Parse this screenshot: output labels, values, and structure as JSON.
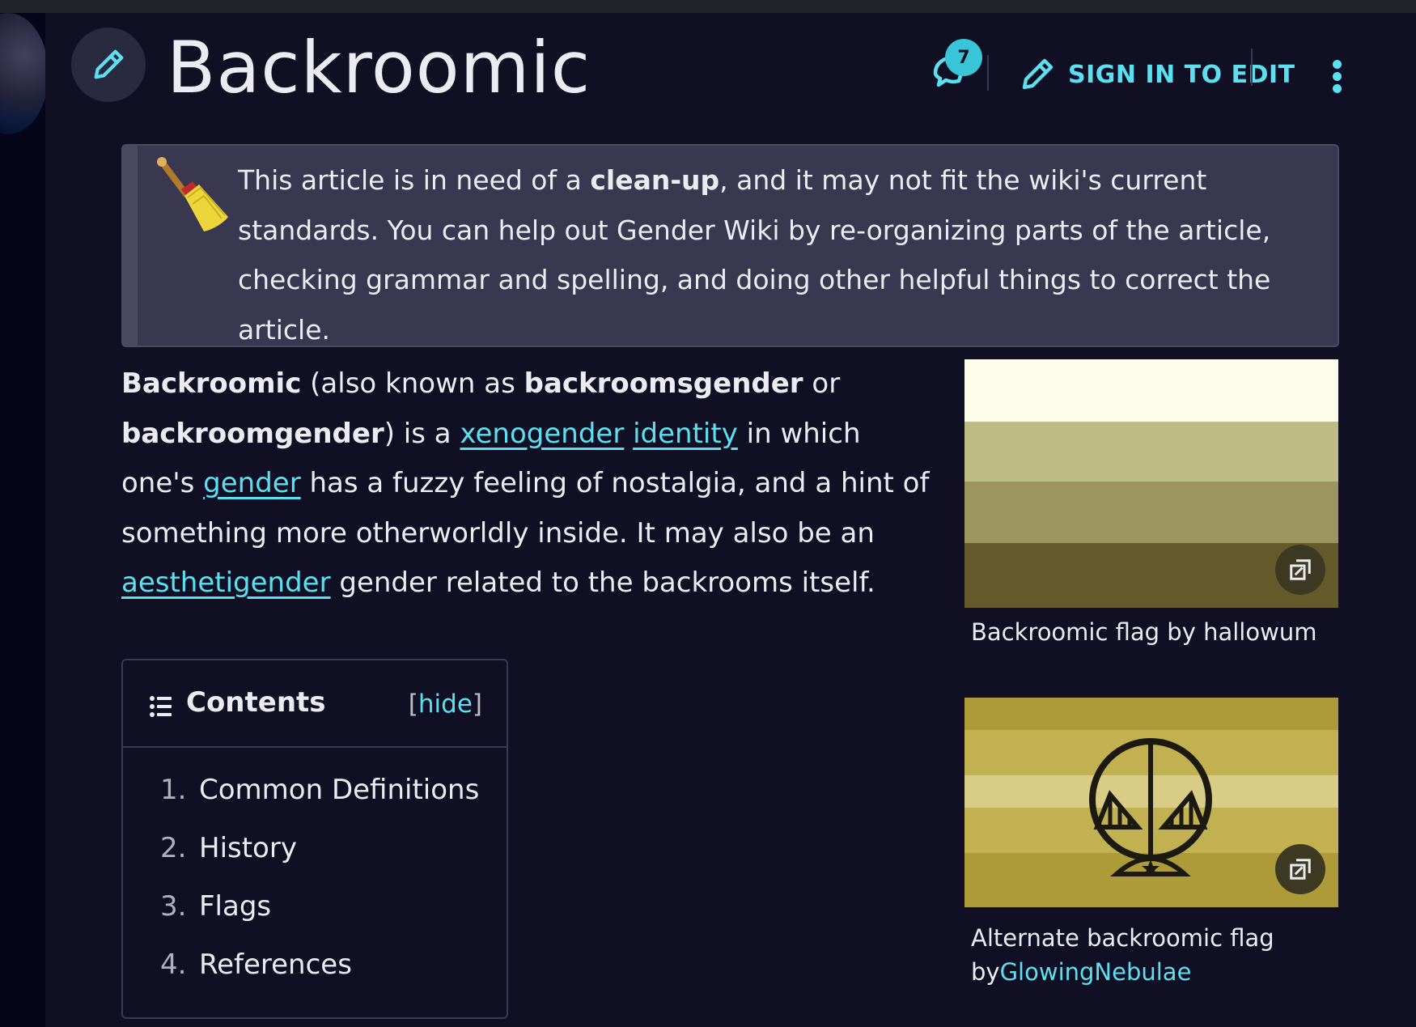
{
  "header": {
    "title": "Backroomic",
    "comment_count": "7",
    "sign_in_label": "SIGN IN TO EDIT"
  },
  "notice": {
    "text_before": "This article is in need of a ",
    "text_bold": "clean-up",
    "text_after": ", and it may not fit the wiki's current standards. You can help out Gender Wiki by re-organizing parts of the article, checking grammar and spelling, and doing other helpful things to correct the article."
  },
  "article": {
    "t1_bold": "Backroomic",
    "t2": " (also known as ",
    "t3_bold": "backroomsgender",
    "t4": " or ",
    "t5_bold": "backroomgender",
    "t6": ") is a ",
    "link_xenogender": "xenogender",
    "t7": " ",
    "link_identity": "identity",
    "t8": " in which one's ",
    "link_gender": "gender",
    "t9": " has a fuzzy feeling of nostalgia, and a hint of something more otherworldly inside. It may also be an ",
    "link_aesthetigender": "aesthetigender",
    "t10": " gender related to the backrooms itself."
  },
  "figures": [
    {
      "caption": "Backroomic flag by hallowum",
      "stripe_colors": [
        "#fdfce8",
        "#bfbd86",
        "#9c955d",
        "#655a2c"
      ]
    },
    {
      "caption_prefix": "Alternate backroomic flag by",
      "caption_link": "GlowingNebulae",
      "stripe_colors": [
        "#ad9b3a",
        "#c2b151",
        "#d8cc86",
        "#c2b151",
        "#ad9b3a"
      ]
    }
  ],
  "toc": {
    "title": "Contents",
    "hide_open": "[",
    "hide_label": "hide",
    "hide_close": "]",
    "items": [
      {
        "num": "1.",
        "label": "Common Definitions"
      },
      {
        "num": "2.",
        "label": "History"
      },
      {
        "num": "3.",
        "label": "Flags"
      },
      {
        "num": "4.",
        "label": "References"
      }
    ]
  },
  "colors": {
    "background": "#100f24",
    "accent": "#5ce0ef",
    "notice_bg": "#393850"
  },
  "icons": [
    "pencil-icon",
    "comment-icon",
    "more-options-icon",
    "broom-icon",
    "expand-icon",
    "list-icon"
  ]
}
